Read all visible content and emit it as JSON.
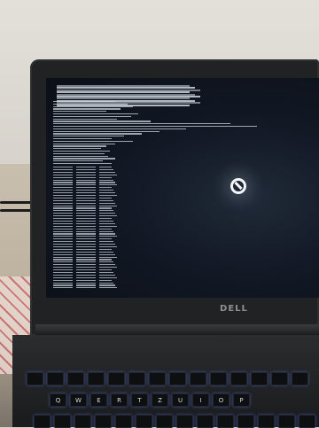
{
  "brand": {
    "logo_text": "DELL"
  },
  "keyboard": {
    "row_top": [],
    "row_letters": [
      "Q",
      "W",
      "E",
      "R",
      "T",
      "Z",
      "U",
      "I",
      "O",
      "P"
    ]
  },
  "screen": {
    "icon": "prohibited-icon"
  },
  "colors": {
    "screen_bg": "#0b0f17",
    "boot_text": "#cfd6df",
    "key_backlight": "#5070e6",
    "bezel": "#202224"
  }
}
